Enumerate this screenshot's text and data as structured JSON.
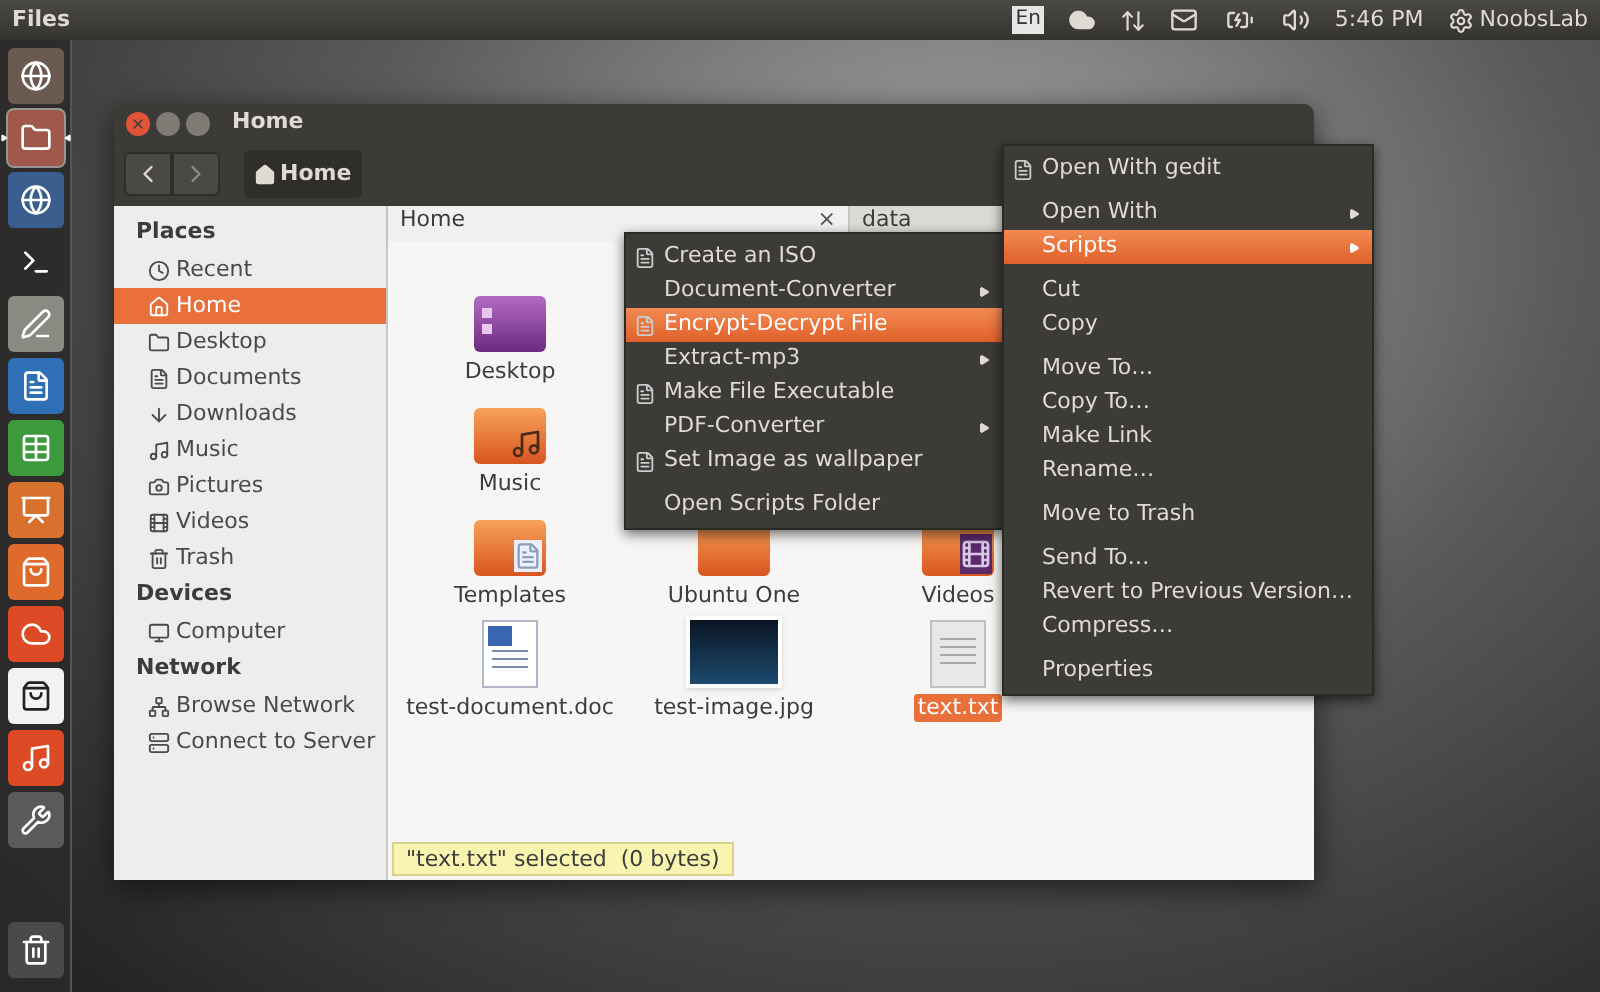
{
  "top_bar": {
    "app_name": "Files",
    "keyboard": "En",
    "time": "5:46 PM",
    "user": "NoobsLab"
  },
  "launcher": {
    "items": [
      {
        "kind": "ubuntu",
        "active": false
      },
      {
        "kind": "files",
        "active": true
      },
      {
        "kind": "firefox",
        "active": false
      },
      {
        "kind": "terminal",
        "active": false
      },
      {
        "kind": "editor",
        "active": false
      },
      {
        "kind": "writer",
        "active": false
      },
      {
        "kind": "calc",
        "active": false
      },
      {
        "kind": "impress",
        "active": false
      },
      {
        "kind": "store",
        "active": false
      },
      {
        "kind": "cloud",
        "active": false
      },
      {
        "kind": "amazon",
        "active": false
      },
      {
        "kind": "music",
        "active": false
      },
      {
        "kind": "tools",
        "active": false
      }
    ],
    "trash": {
      "kind": "trash",
      "active": false
    }
  },
  "window": {
    "title": "Home",
    "path_button": "Home",
    "sidebar": {
      "sections": [
        {
          "heading": "Places",
          "items": [
            {
              "label": "Recent",
              "selected": false
            },
            {
              "label": "Home",
              "selected": true
            },
            {
              "label": "Desktop",
              "selected": false
            },
            {
              "label": "Documents",
              "selected": false
            },
            {
              "label": "Downloads",
              "selected": false
            },
            {
              "label": "Music",
              "selected": false
            },
            {
              "label": "Pictures",
              "selected": false
            },
            {
              "label": "Videos",
              "selected": false
            },
            {
              "label": "Trash",
              "selected": false
            }
          ]
        },
        {
          "heading": "Devices",
          "items": [
            {
              "label": "Computer",
              "selected": false
            }
          ]
        },
        {
          "heading": "Network",
          "items": [
            {
              "label": "Browse Network",
              "selected": false
            },
            {
              "label": "Connect to Server",
              "selected": false
            }
          ]
        }
      ]
    },
    "tabs": [
      {
        "label": "Home",
        "selected": true,
        "close": "×"
      },
      {
        "label": "data",
        "selected": false
      }
    ],
    "file_columns": [
      [
        {
          "name": "Desktop",
          "kind": "desktop",
          "selected": false
        },
        {
          "name": "Music",
          "kind": "music",
          "selected": false
        },
        {
          "name": "Templates",
          "kind": "templates",
          "selected": false
        },
        {
          "name": "test-document.doc",
          "kind": "document",
          "selected": false
        }
      ],
      [
        {
          "name": "Ubuntu One",
          "kind": "folder",
          "selected": false
        },
        {
          "name": "test-image.jpg",
          "kind": "image",
          "selected": false
        }
      ],
      [
        {
          "name": "Videos",
          "kind": "videos",
          "selected": false
        },
        {
          "name": "text.txt",
          "kind": "text",
          "selected": true
        }
      ]
    ],
    "status": "\"text.txt\" selected  (0 bytes)"
  },
  "scripts_menu": {
    "groups": [
      [
        {
          "label": "Create an ISO",
          "icon": true,
          "submenu": false,
          "selected": false
        },
        {
          "label": "Document-Converter",
          "icon": false,
          "submenu": true,
          "selected": false
        },
        {
          "label": "Encrypt-Decrypt File",
          "icon": true,
          "submenu": false,
          "selected": true
        },
        {
          "label": "Extract-mp3",
          "icon": false,
          "submenu": true,
          "selected": false
        },
        {
          "label": "Make File Executable",
          "icon": true,
          "submenu": false,
          "selected": false
        },
        {
          "label": "PDF-Converter",
          "icon": false,
          "submenu": true,
          "selected": false
        },
        {
          "label": "Set Image as wallpaper",
          "icon": true,
          "submenu": false,
          "selected": false
        }
      ],
      [
        {
          "label": "Open Scripts Folder",
          "icon": false,
          "submenu": false,
          "selected": false
        }
      ]
    ]
  },
  "context_menu": {
    "groups": [
      [
        {
          "label": "Open With gedit",
          "icon": true,
          "submenu": false,
          "selected": false
        }
      ],
      [
        {
          "label": "Open With",
          "icon": false,
          "submenu": true,
          "selected": false
        },
        {
          "label": "Scripts",
          "icon": false,
          "submenu": true,
          "selected": true
        }
      ],
      [
        {
          "label": "Cut",
          "icon": false,
          "submenu": false,
          "selected": false
        },
        {
          "label": "Copy",
          "icon": false,
          "submenu": false,
          "selected": false
        }
      ],
      [
        {
          "label": "Move To…",
          "icon": false,
          "submenu": false,
          "selected": false
        },
        {
          "label": "Copy To…",
          "icon": false,
          "submenu": false,
          "selected": false
        },
        {
          "label": "Make Link",
          "icon": false,
          "submenu": false,
          "selected": false
        },
        {
          "label": "Rename…",
          "icon": false,
          "submenu": false,
          "selected": false
        }
      ],
      [
        {
          "label": "Move to Trash",
          "icon": false,
          "submenu": false,
          "selected": false
        }
      ],
      [
        {
          "label": "Send To…",
          "icon": false,
          "submenu": false,
          "selected": false
        },
        {
          "label": "Revert to Previous Version…",
          "icon": false,
          "submenu": false,
          "selected": false
        },
        {
          "label": "Compress…",
          "icon": false,
          "submenu": false,
          "selected": false
        }
      ],
      [
        {
          "label": "Properties",
          "icon": false,
          "submenu": false,
          "selected": false
        }
      ]
    ]
  }
}
